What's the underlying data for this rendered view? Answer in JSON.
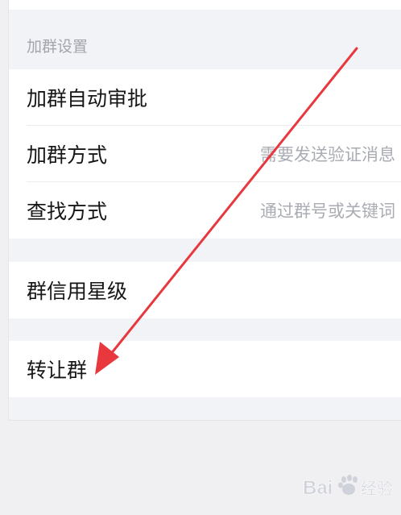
{
  "section_header": "加群设置",
  "rows": [
    {
      "label": "加群自动审批",
      "value": ""
    },
    {
      "label": "加群方式",
      "value": "需要发送验证消息"
    },
    {
      "label": "查找方式",
      "value": "通过群号或关键词"
    },
    {
      "label": "群信用星级",
      "value": ""
    },
    {
      "label": "转让群",
      "value": ""
    }
  ],
  "colors": {
    "arrow": "#e8383d",
    "background": "#f2f3f7"
  },
  "watermark": {
    "logo_text": "Bai 经验",
    "icon": "baidu-paw-icon"
  }
}
